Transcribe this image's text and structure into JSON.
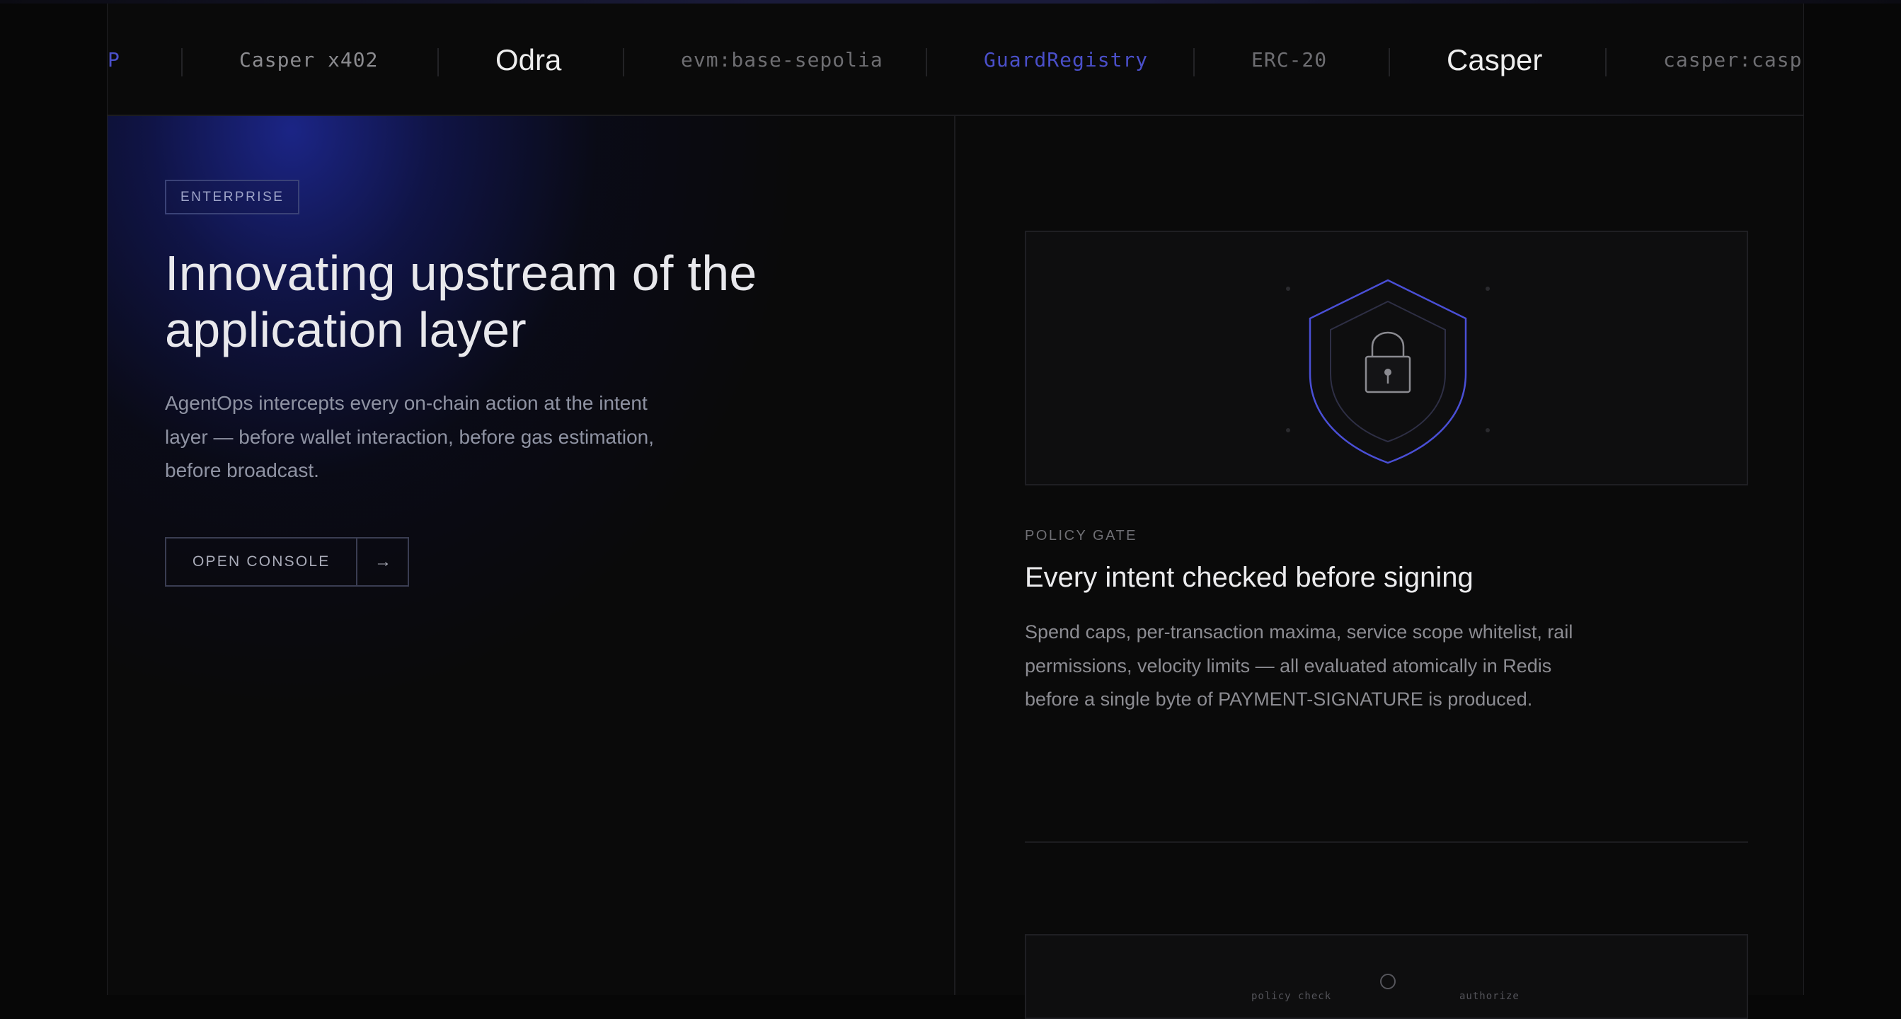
{
  "marquee": {
    "items": [
      {
        "text": "P",
        "style": "mono-accent"
      },
      {
        "text": "Casper x402",
        "style": "mono"
      },
      {
        "text": "Odra",
        "style": "sans"
      },
      {
        "text": "evm:base-sepolia",
        "style": "mono-dim"
      },
      {
        "text": "GuardRegistry",
        "style": "mono-accent"
      },
      {
        "text": "ERC-20",
        "style": "mono-dim"
      },
      {
        "text": "Casper",
        "style": "sans"
      },
      {
        "text": "casper:caspe",
        "style": "mono-dim"
      }
    ]
  },
  "hero": {
    "badge": "ENTERPRISE",
    "title": "Innovating upstream of the application layer",
    "description": "AgentOps intercepts every on-chain action at the intent layer — before wallet interaction, before gas estimation, before broadcast.",
    "cta_label": "OPEN CONSOLE",
    "cta_arrow": "→"
  },
  "feature": {
    "eyebrow": "POLICY GATE",
    "title": "Every intent checked before signing",
    "description": "Spend caps, per-transaction maxima, service scope whitelist, rail permissions, velocity limits — all evaluated atomically in Redis before a single byte of PAYMENT-SIGNATURE is produced."
  },
  "flow": {
    "left_label": "policy check",
    "right_label": "authorize"
  },
  "colors": {
    "accent": "#4a4fc9",
    "background": "#0a0a0a",
    "shield_stroke": "#4a4fd6"
  },
  "icons": {
    "shield": "shield-lock-icon",
    "arrow": "arrow-right-icon"
  }
}
